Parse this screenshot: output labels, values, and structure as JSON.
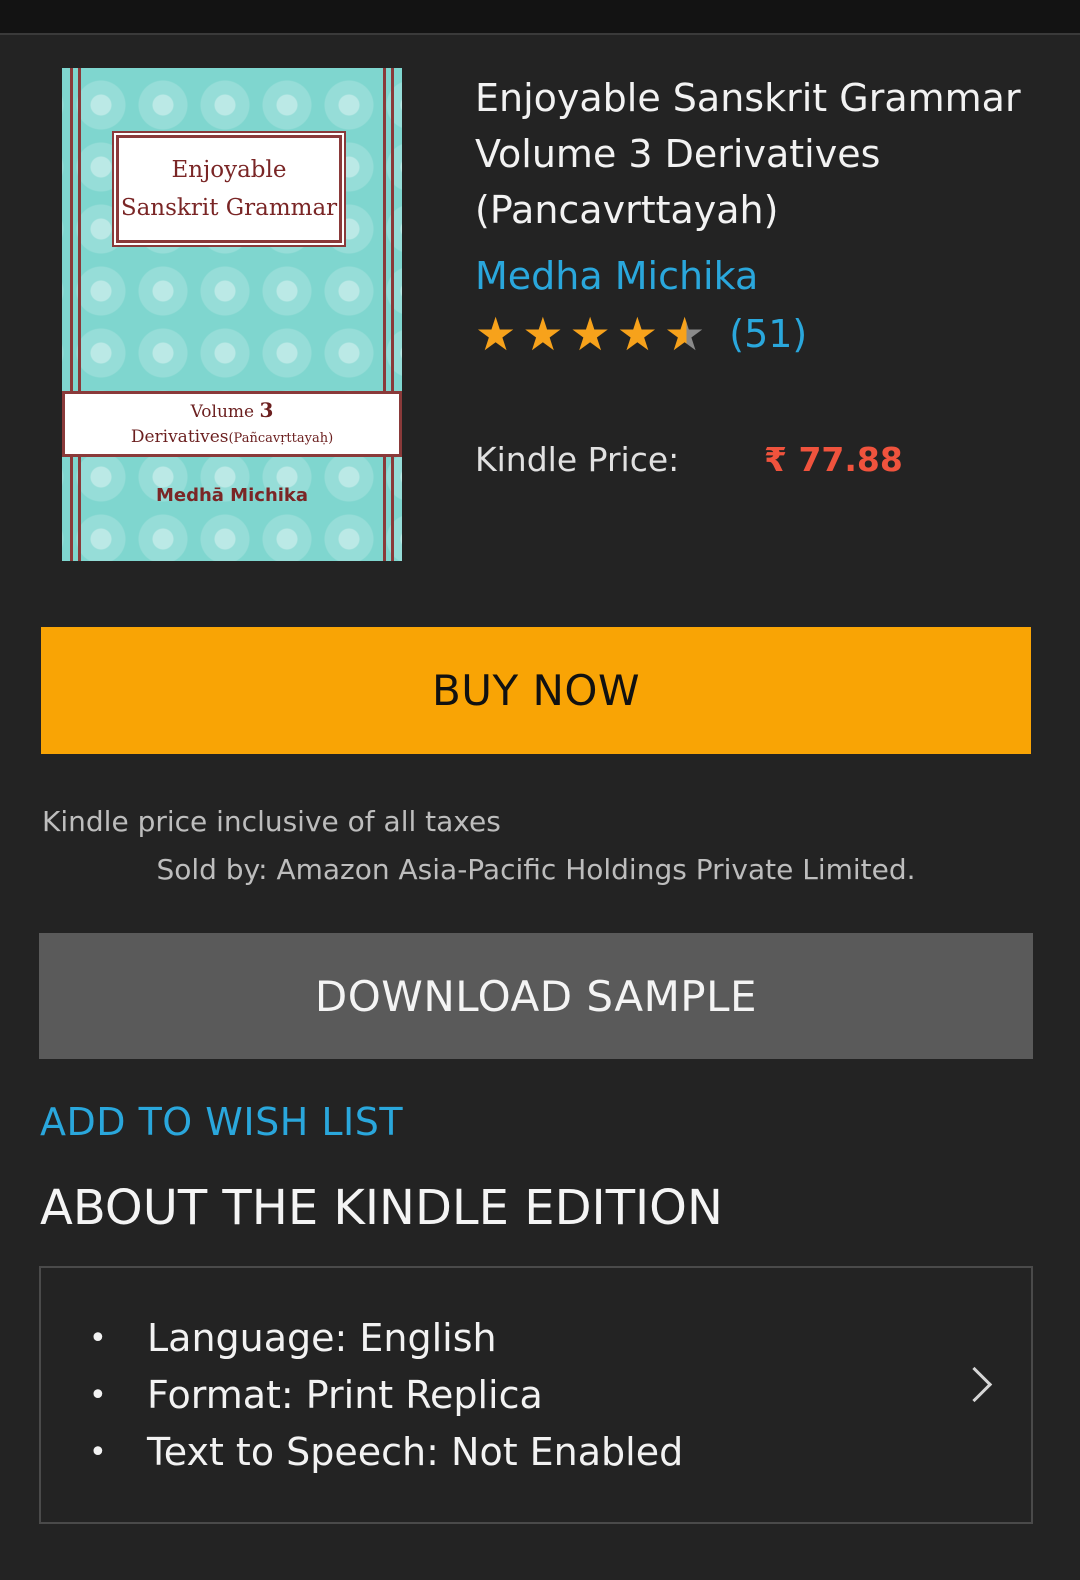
{
  "cover": {
    "title_line1": "Enjoyable",
    "title_line2": "Sanskrit Grammar",
    "volume_word": "Volume",
    "volume_number": "3",
    "subtitle_main": "Derivatives",
    "subtitle_paren": "(Pañcavṛttayaḥ)",
    "author": "Medhā Michika"
  },
  "book": {
    "title": "Enjoyable Sanskrit Grammar Volume 3 Derivatives (Pancavrttayah)",
    "author": "Medha Michika",
    "rating": 4.5,
    "rating_count": "(51)",
    "price_label": "Kindle Price:",
    "price": "₹ 77.88"
  },
  "actions": {
    "buy_now": "BUY NOW",
    "tax_note": "Kindle price inclusive of all taxes",
    "sold_by": "Sold by: Amazon Asia-Pacific Holdings Private Limited.",
    "download_sample": "DOWNLOAD SAMPLE",
    "add_to_wishlist": "ADD TO WISH LIST"
  },
  "about": {
    "heading": "ABOUT THE KINDLE EDITION",
    "items": [
      {
        "text": "Language: English"
      },
      {
        "text": "Format: Print Replica"
      },
      {
        "text": "Text to Speech: Not Enabled"
      }
    ],
    "bullet": "•"
  },
  "colors": {
    "background": "#232323",
    "accent_link": "#2aa7dc",
    "buy_button": "#f9a405",
    "sample_button": "#5a5a5a",
    "price": "#f0533d",
    "star": "#f7a21b"
  },
  "icons": {
    "star": "star-icon",
    "chevron": "chevron-right-icon"
  }
}
